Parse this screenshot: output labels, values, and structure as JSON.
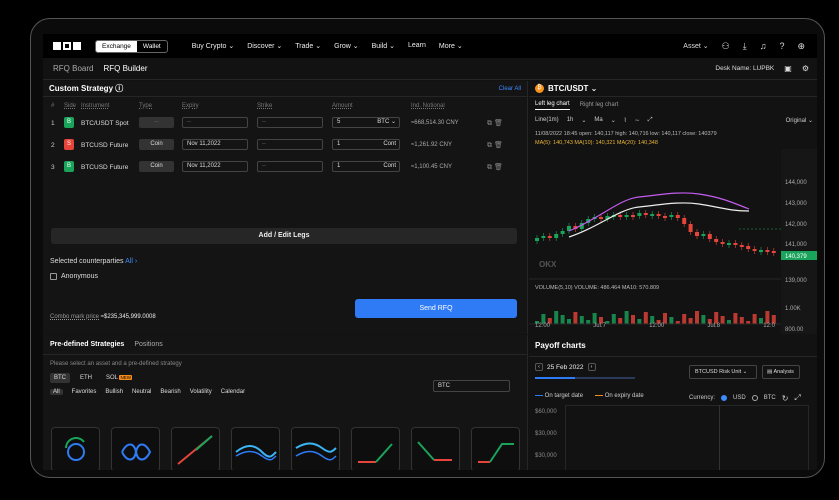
{
  "nav": {
    "exchange": "Exchange",
    "wallet": "Wallet",
    "items": [
      "Buy Crypto ⌄",
      "Discover ⌄",
      "Trade ⌄",
      "Grow ⌄",
      "Build ⌄",
      "Learn",
      "More ⌄"
    ],
    "asset": "Asset ⌄"
  },
  "subnav": {
    "rfq_board": "RFQ Board",
    "rfq_builder": "RFQ Builder",
    "desk": "Desk Name: LUPBK"
  },
  "custom": {
    "title": "Custom Strategy ⓘ",
    "clear_all": "Clear All",
    "headers": [
      "#",
      "Side",
      "Instrument",
      "Type",
      "Expiry",
      "Strike",
      "Amount",
      "Ind. Notional"
    ],
    "rows": [
      {
        "num": "1",
        "side": "B",
        "side_color": "#1aa35b",
        "instrument": "BTC/USDT Spot",
        "type": "--",
        "expiry": "--",
        "strike": "--",
        "amount": "5",
        "unit": "BTC ⌄",
        "notional": "≈668,514.30 CNY"
      },
      {
        "num": "2",
        "side": "S",
        "side_color": "#e5453a",
        "instrument": "BTCUSD Future",
        "type": "Coin",
        "expiry": "Nov 11,2022",
        "strike": "--",
        "amount": "1",
        "unit": "Cont",
        "notional": "≈1,261.92 CNY"
      },
      {
        "num": "3",
        "side": "B",
        "side_color": "#1aa35b",
        "instrument": "BTCUSD Future",
        "type": "Coin",
        "expiry": "Nov 11,2022",
        "strike": "--",
        "amount": "1",
        "unit": "Cont",
        "notional": "≈1,100.45 CNY"
      }
    ],
    "add_legs": "Add / Edit Legs",
    "counterparties": "Selected counterparties",
    "cp_all": "All ›",
    "anonymous": "Anonymous",
    "send_rfq": "Send RFQ",
    "combo_label": "Combo mark price",
    "combo_value": "≈$235,345,999.0008"
  },
  "chart": {
    "pair": "BTC/USDT ⌄",
    "tabs": [
      "Left leg chart",
      "Right leg chart"
    ],
    "tools": [
      "Line(1m)",
      "1h",
      "⌄",
      "Ma",
      "⌄"
    ],
    "original": "Original ⌄",
    "info": "11/08/2022 18:45  open: 140,117  high: 140,716  low: 140,117  close: 140379",
    "ma": "MA(5): 140,743   MA(10): 140,321   MA(20): 140,348",
    "volume": "VOLUME(5,10)  VOLUME: 486.464   MA10: 570.809",
    "yticks": [
      "144,000",
      "143,000",
      "142,000",
      "141,000",
      "140,379",
      "139,000",
      "1.00K",
      "800.00"
    ],
    "xticks": [
      "12:00",
      "Jul.7",
      "12:00",
      "Jul.8",
      "12:0"
    ]
  },
  "predefined": {
    "tabs": [
      "Pre-defined Strategies",
      "Positions"
    ],
    "hint": "Please select an asset and a pre-defined strategy",
    "assets": [
      "BTC",
      "ETH",
      "SOL"
    ],
    "new_badge": "NEW",
    "select": "BTC",
    "filters": [
      "All",
      "Favorites",
      "Bullish",
      "Neutral",
      "Bearish",
      "Volatility",
      "Calendar"
    ]
  },
  "payoff": {
    "title": "Payoff charts",
    "date": "25 Feb 2022",
    "risk_unit": "BTCUSD Risk Unit ⌄",
    "analysis": "Analysis",
    "legend_target": "On target date",
    "legend_expiry": "On expiry date",
    "currency": "Currency:",
    "usd": "USD",
    "btc": "BTC",
    "yticks": [
      "$60,000",
      "$30,000",
      "$30,000"
    ]
  },
  "colors": {
    "up": "#1aa35b",
    "down": "#e5453a",
    "accent": "#2e7bf5",
    "btc": "#f7931a"
  }
}
